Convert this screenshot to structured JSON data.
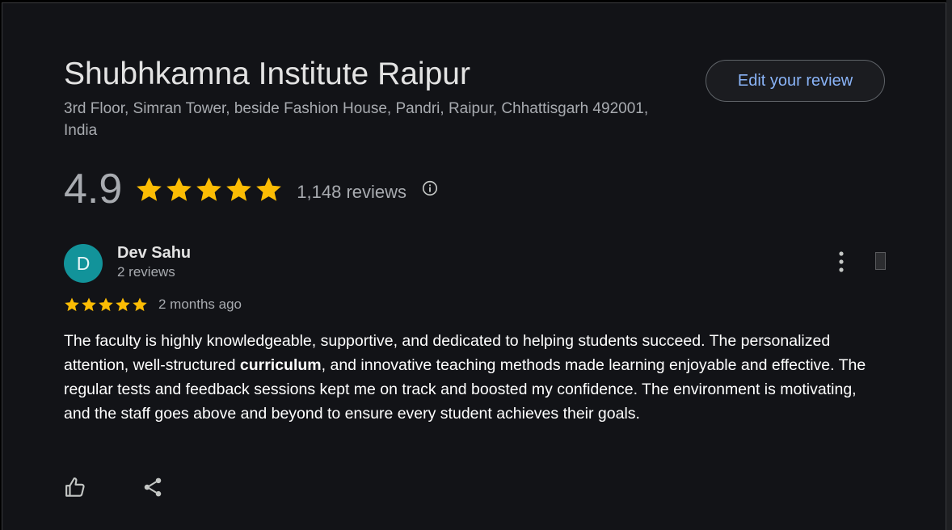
{
  "place": {
    "name": "Shubhkamna Institute Raipur",
    "address": "3rd Floor, Simran Tower, beside Fashion House, Pandri, Raipur, Chhattisgarh 492001, India",
    "edit_review_label": "Edit your review",
    "rating": "4.9",
    "rating_stars": 5,
    "review_count": "1,148 reviews"
  },
  "review": {
    "avatar_letter": "D",
    "reviewer_name": "Dev Sahu",
    "reviewer_reviews": "2 reviews",
    "rating_stars": 5,
    "time_ago": "2 months ago",
    "text_part1": "The faculty is highly knowledgeable, supportive, and dedicated to helping students succeed. The personalized attention, well-structured ",
    "text_bold": "curriculum",
    "text_part2": ", and innovative teaching methods made learning enjoyable and effective. The regular tests and feedback sessions kept me on track and boosted my confidence. The environment is motivating, and the staff goes above and beyond to ensure every student achieves their goals."
  },
  "icons": {
    "info": "info-icon",
    "more": "more-vert-icon",
    "like": "thumbs-up-icon",
    "share": "share-icon",
    "star": "star-icon"
  },
  "colors": {
    "background": "#121317",
    "star": "#fbbc04",
    "link": "#8ab4f8",
    "avatar": "#12939a",
    "muted_text": "#a8abb0"
  }
}
